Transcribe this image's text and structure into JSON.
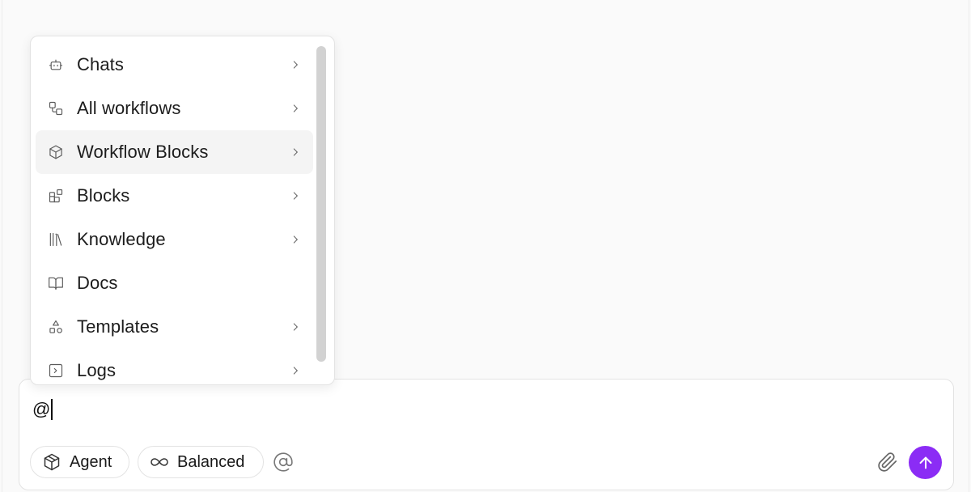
{
  "mention_menu": {
    "items": [
      {
        "label": "Chats",
        "icon": "bot-icon",
        "has_submenu": true
      },
      {
        "label": "All workflows",
        "icon": "workflow-icon",
        "has_submenu": true
      },
      {
        "label": "Workflow Blocks",
        "icon": "cube-icon",
        "has_submenu": true,
        "highlighted": true
      },
      {
        "label": "Blocks",
        "icon": "blocks-icon",
        "has_submenu": true
      },
      {
        "label": "Knowledge",
        "icon": "library-icon",
        "has_submenu": true
      },
      {
        "label": "Docs",
        "icon": "book-open-icon",
        "has_submenu": false
      },
      {
        "label": "Templates",
        "icon": "shapes-icon",
        "has_submenu": true
      },
      {
        "label": "Logs",
        "icon": "terminal-square-icon",
        "has_submenu": true
      }
    ]
  },
  "composer": {
    "input_value": "@",
    "mode_label": "Agent",
    "mode_icon": "package-icon",
    "depth_label": "Balanced",
    "depth_icon": "infinity-icon",
    "mention_icon": "at-sign-icon",
    "attach_icon": "paperclip-icon",
    "send_icon": "arrow-up-icon",
    "send_color": "#8b2cf5"
  }
}
